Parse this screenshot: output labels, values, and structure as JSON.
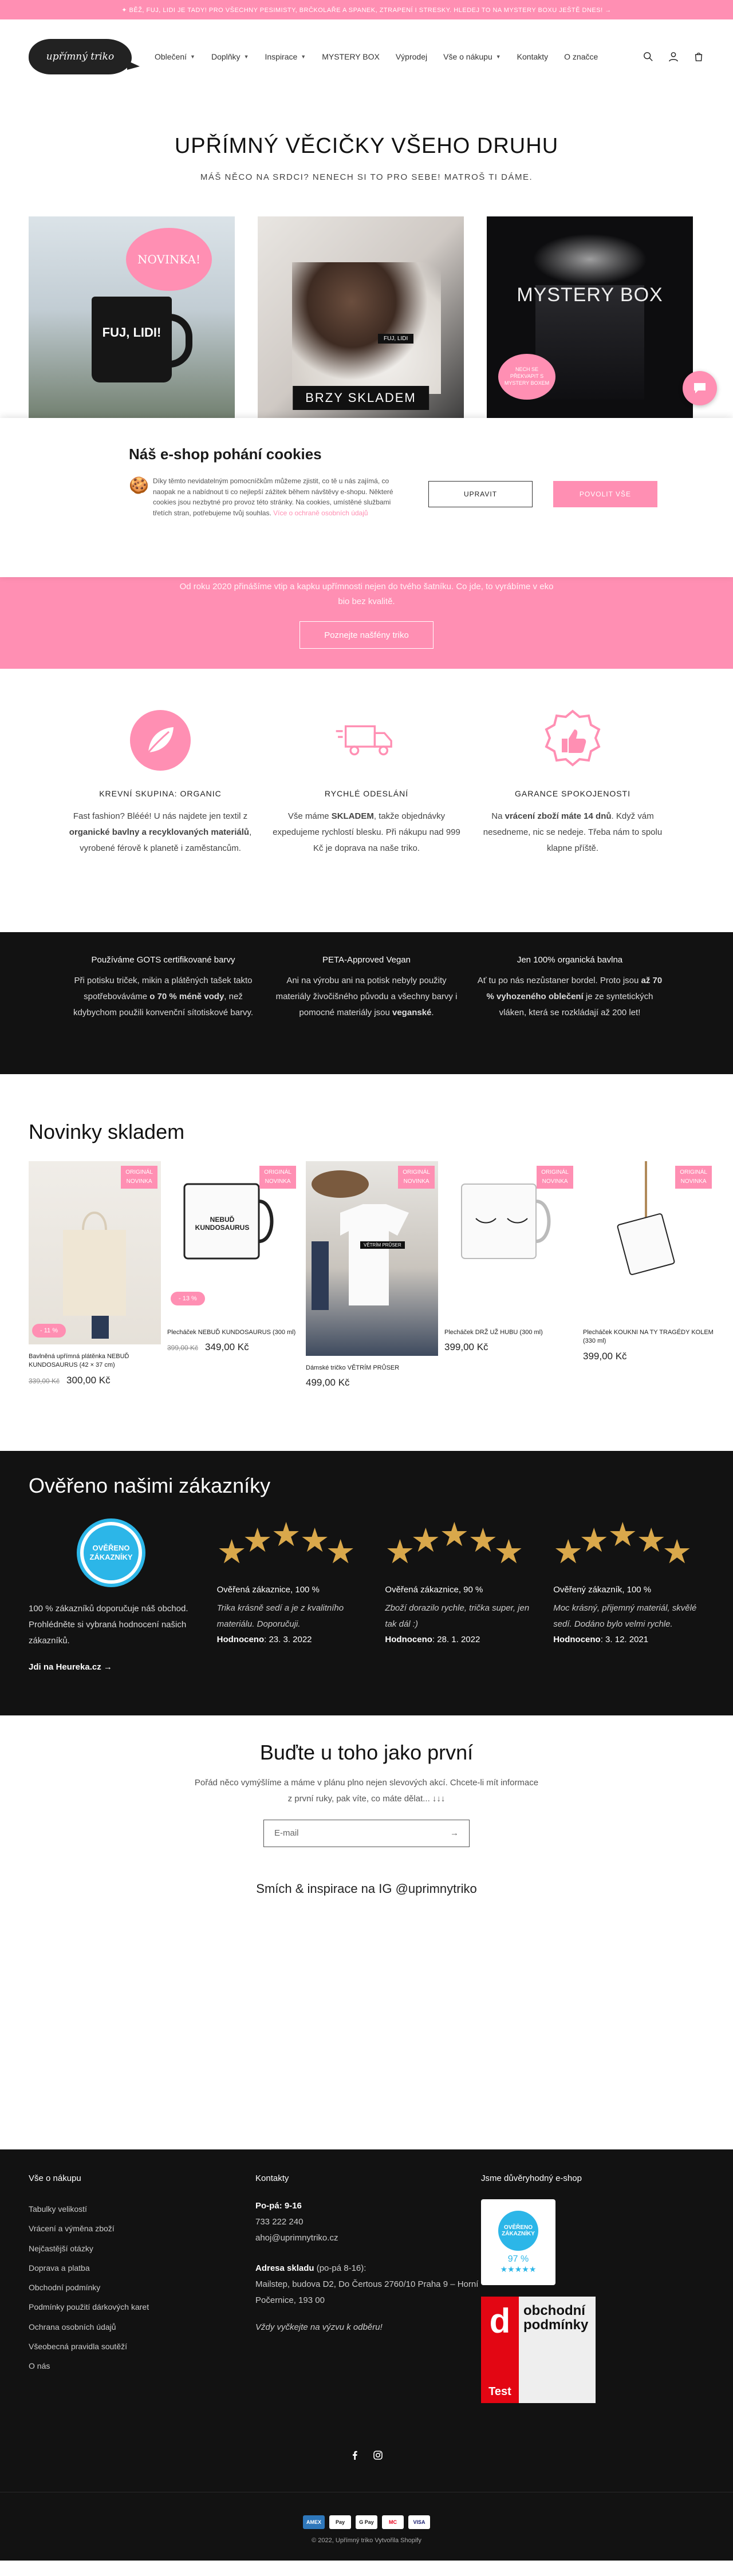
{
  "announcement": "✦ BĚŽ, FUJ, LIDI JE TADY! PRO VŠECHNY PESIMISTY, BRČKOLAŘE A SPANEK, ZTRAPENÍ I STRESKY. HLEDEJ TO NA MYSTERY BOXU JEŠTĚ DNES! →",
  "logo": "upřímný triko",
  "nav": [
    {
      "label": "Oblečení",
      "dropdown": true
    },
    {
      "label": "Doplňky",
      "dropdown": true
    },
    {
      "label": "Inspirace",
      "dropdown": true
    },
    {
      "label": "MYSTERY BOX",
      "dropdown": false
    },
    {
      "label": "Výprodej",
      "dropdown": false
    },
    {
      "label": "Vše o nákupu",
      "dropdown": true
    },
    {
      "label": "Kontakty",
      "dropdown": false
    },
    {
      "label": "O značce",
      "dropdown": false
    }
  ],
  "hero": {
    "title": "UPŘÍMNÝ VĚCIČKY VŠEHO DRUHU",
    "subtitle": "MÁŠ NĚCO NA SRDCI? NENECH SI TO PRO SEBE! MATROŠ TI DÁME."
  },
  "promo": {
    "card1_cloud": "NOVINKA!",
    "card1_mug": "FUJ, LIDI!",
    "card2_tag": "FUJ, LIDI",
    "card2_banner": "BRZY SKLADEM",
    "card3_title": "MYSTERY BOX",
    "card3_cloud": "NECH SE PŘEKVAPIT S MYSTERY BOXEM"
  },
  "cookie": {
    "title": "Náš e-shop pohání cookies",
    "text": "Díky těmto nevidatelným pomocníčkům můžeme zjistit, co tě u nás zajímá, co naopak ne a nabídnout ti co nejlepší zážitek během návštěvy e-shopu. Některé cookies jsou nezbytné pro provoz této stránky. Na cookies, umístěné službami třetích stran, potřebujeme tvůj souhlas. ",
    "link": "Více o ochraně osobních údajů",
    "btn_setup": "UPRAVIT",
    "btn_accept": "POVOLIT VŠE"
  },
  "pink_band": {
    "text_line1": "Od roku 2020 přinášíme vtip a kapku upřímnosti nejen do tvého šatníku. Co jde, to vyrábíme v eko",
    "text_line2": "bio bez kvalitě.",
    "button": "Poznejte našfény triko"
  },
  "features": [
    {
      "icon": "leaf-icon",
      "title": "KREVNÍ SKUPINA: ORGANIC",
      "text_before": "Fast fashion? Blééé! U nás najdete jen textil z ",
      "text_bold": "organické bavlny a recyklovaných materiálů",
      "text_after": ", vyrobené férově k planetě i zaměstancům."
    },
    {
      "icon": "truck-icon",
      "title": "RYCHLÉ ODESLÁNÍ",
      "text_before": "Vše máme ",
      "text_bold": "SKLADEM",
      "text_after": ", takže objednávky expedujeme rychlostí blesku. Při nákupu nad 999 Kč je doprava na naše triko."
    },
    {
      "icon": "thumbs-up-icon",
      "title": "GARANCE SPOKOJENOSTI",
      "text_before": "Na ",
      "text_bold": "vrácení zboží máte 14 dnů",
      "text_after": ". Když vám nesedneme, nic se nedeje. Třeba nám to spolu klapne příště."
    }
  ],
  "dark_info": [
    {
      "title": "Používáme GOTS certifikované barvy",
      "text_before": "Při potisku triček, mikin a plátěných tašek takto spotřebováváme ",
      "text_bold": "o 70 % méně vody",
      "text_after": ", než kdybychom použili konvenční sítotiskové barvy."
    },
    {
      "title": "PETA-Approved Vegan",
      "text_before": "Ani na výrobu ani na potisk nebyly použity materiály živočišného původu a všechny barvy i pomocné materiály jsou ",
      "text_bold": "veganské",
      "text_after": "."
    },
    {
      "title": "Jen 100% organická bavlna",
      "text_before": "Ať tu po nás nezůstaner bordel. Proto jsou ",
      "text_bold": "až 70 % vyhozeného oblečení",
      "text_after": " je ze syntetických vláken, která se rozkládají až 200 let!"
    }
  ],
  "products": {
    "heading": "Novinky skladem",
    "badge_line1": "ORIGINÁL",
    "badge_line2": "NOVINKA",
    "items": [
      {
        "name": "Bavlněná upřímná plátěnka NEBUĎ KUNDOSAURUS (42 × 37 cm)",
        "old": "339,00 Kč",
        "price": "300,00 Kč",
        "sale": "- 11 %"
      },
      {
        "name": "Plecháček NEBUĎ KUNDOSAURUS (300 ml)",
        "old": "399,00 Kč",
        "price": "349,00 Kč",
        "sale": "- 13 %"
      },
      {
        "name": "Dámské tričko VĚTRÍM PRŮSER",
        "old": "",
        "price": "499,00 Kč",
        "sale": ""
      },
      {
        "name": "Plecháček DRŽ UŽ HUBU (300 ml)",
        "old": "",
        "price": "399,00 Kč",
        "sale": ""
      },
      {
        "name": "Plecháček KOUKNI NA TY TRAGÉDY KOLEM (330 ml)",
        "old": "",
        "price": "399,00 Kč",
        "sale": ""
      }
    ],
    "mug1_text": "NEBUĎ KUNDOSAURUS",
    "tee_text": "VĚTRÍM PRŮSER"
  },
  "reviews": {
    "heading": "Ověřeno našimi zákazníky",
    "badge": "OVĚŘENO ZÁKAZNÍKY",
    "badge_brand": "Heureka",
    "left_text": "100 % zákazníků doporučuje náš obchod. Prohlédněte si vybraná hodnocení našich zákazníků.",
    "left_link": "Jdi na Heureka.cz",
    "items": [
      {
        "title": "Ověřená zákaznice, 100 %",
        "quote": "Trika krásně sedí a je z kvalitního materiálu. Doporučuji.",
        "label": "Hodnoceno",
        "date": ": 23. 3. 2022"
      },
      {
        "title": "Ověřená zákaznice, 90 %",
        "quote": "Zboží dorazilo rychle, trička super, jen tak dál :)",
        "label": "Hodnoceno",
        "date": ": 28. 1. 2022"
      },
      {
        "title": "Ověřený zákazník, 100 %",
        "quote": "Moc krásný, přijemný materiál, skvělé sedí. Dodáno bylo velmi rychle.",
        "label": "Hodnoceno",
        "date": ": 3. 12. 2021"
      }
    ]
  },
  "newsletter": {
    "heading": "Buďte u toho jako první",
    "text_line1": "Pořád něco vymýšlíme a máme v plánu plno nejen slevových akcí. Chcete-li mít informace",
    "text_line2": "z první ruky, pak víte, co máte dělat... ↓↓↓",
    "placeholder": "E-mail"
  },
  "insta": "Smích & inspirace na IG @uprimnytriko",
  "footer": {
    "col1_title": "Vše o nákupu",
    "col1_items": [
      "Tabulky velikostí",
      "Vrácení a výměna zboží",
      "Nejčastější otázky",
      "Doprava a platba",
      "Obchodní podmínky",
      "Podmínky použití dárkových karet",
      "Ochrana osobních údajů",
      "Všeobecná pravidla soutěží",
      "O nás"
    ],
    "col2_title": "Kontakty",
    "hours_label": "Po-pá: 9-16",
    "phone": "733 222 240",
    "email": "ahoj@uprimnytriko.cz",
    "address_label": "Adresa skladu",
    "address_hours": " (po-pá 8-16):",
    "address": "Mailstep, budova D2, Do Čertous 2760/10 Praha 9 – Horní Počernice, 193 00",
    "note": "Vždy vyčkejte na výzvu k odběru!",
    "col3_title": "Jsme důvěryhodný e-shop",
    "trust_badge": "OVĚŘENO ZÁKAZNÍKY",
    "trust_pct": "97 %",
    "dtest_letter": "d",
    "dtest_word": "Test",
    "dtest_text": "obchodní podmínky"
  },
  "payments": [
    "AMEX",
    "Pay",
    "G Pay",
    "MC",
    "VISA"
  ],
  "copyright": "© 2022, Upřímný triko Vytvořila Shopify"
}
